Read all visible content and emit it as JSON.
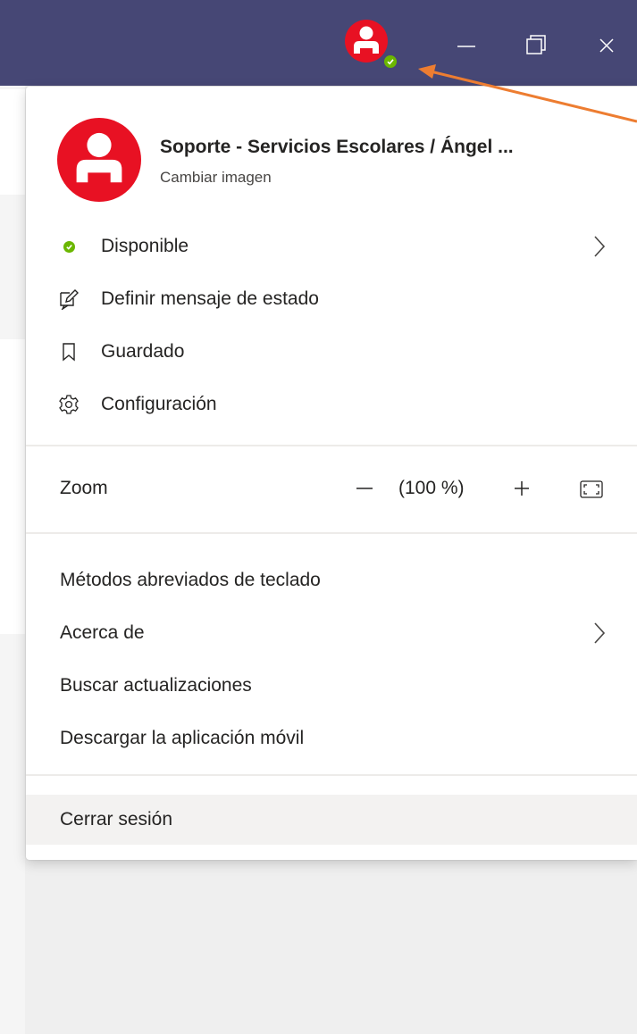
{
  "colors": {
    "titlebar": "#464775",
    "avatar": "#e81123",
    "presence_available": "#6bb700",
    "annotation_arrow": "#ed7d31"
  },
  "titlebar": {
    "avatar_icon": "person-icon",
    "presence_icon": "check-icon",
    "buttons": [
      "minimize-icon",
      "restore-icon",
      "close-icon"
    ]
  },
  "profile": {
    "name": "Soporte - Servicios Escolares / Ángel ...",
    "change_picture": "Cambiar imagen"
  },
  "menu": {
    "status": {
      "label": "Disponible",
      "icon": "status-available-icon"
    },
    "status_message": {
      "label": "Definir mensaje de estado",
      "icon": "edit-message-icon"
    },
    "saved": {
      "label": "Guardado",
      "icon": "bookmark-icon"
    },
    "settings": {
      "label": "Configuración",
      "icon": "gear-icon"
    },
    "zoom": {
      "label": "Zoom",
      "value": "(100 %)"
    },
    "shortcuts": "Métodos abreviados de teclado",
    "about": "Acerca de",
    "check_updates": "Buscar actualizaciones",
    "download_app": "Descargar la aplicación móvil",
    "sign_out": "Cerrar sesión"
  }
}
